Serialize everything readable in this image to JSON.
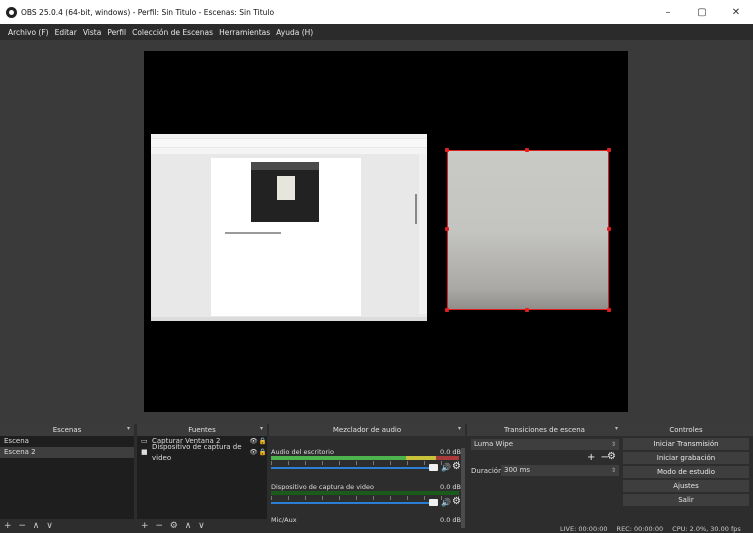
{
  "window": {
    "title": "OBS 25.0.4 (64-bit, windows) - Perfil: Sin Titulo - Escenas: Sin Titulo",
    "controls": {
      "minimize": "–",
      "maximize": "▢",
      "close": "✕"
    }
  },
  "menu": [
    "Archivo (F)",
    "Editar",
    "Vista",
    "Perfil",
    "Colección de Escenas",
    "Herramientas",
    "Ayuda (H)"
  ],
  "preview": {
    "canvas_color": "#000000",
    "selection_color": "#e02020"
  },
  "docks": {
    "scenes": {
      "title": "Escenas",
      "items": [
        {
          "label": "Escena",
          "selected": false
        },
        {
          "label": "Escena 2",
          "selected": true
        }
      ],
      "footer": "+ − ∧ ∨"
    },
    "sources": {
      "title": "Fuentes",
      "items": [
        {
          "icon": "window-capture-icon",
          "glyph": "▭",
          "label": "Capturar Ventana 2"
        },
        {
          "icon": "video-capture-icon",
          "glyph": "■",
          "label": "Dispositivo de captura de video"
        }
      ],
      "eye": "👁",
      "lock": "🔒",
      "footer": "+ − ⚙ ∧ ∨"
    },
    "mixer": {
      "title": "Mezclador de audio",
      "entries": [
        {
          "name": "Audio del escritorio",
          "db": "0.0 dB"
        },
        {
          "name": "Dispositivo de captura de video",
          "db": "0.0 dB"
        },
        {
          "name": "Mic/Aux",
          "db": "0.0 dB"
        }
      ],
      "mute_glyph": "🔊",
      "gear_glyph": "⚙"
    },
    "transitions": {
      "title": "Transiciones de escena",
      "selected": "Luma Wipe",
      "add_remove": "+ −",
      "gear": "⚙",
      "duration_label": "Duración",
      "duration_value": "300 ms"
    },
    "controls": {
      "title": "Controles",
      "buttons": [
        "Iniciar Transmisión",
        "Iniciar grabación",
        "Modo de estudio",
        "Ajustes",
        "Salir"
      ]
    }
  },
  "status": {
    "live": "LIVE: 00:00:00",
    "rec": "REC: 00:00:00",
    "cpu": "CPU: 2.0%, 30.00 fps"
  }
}
